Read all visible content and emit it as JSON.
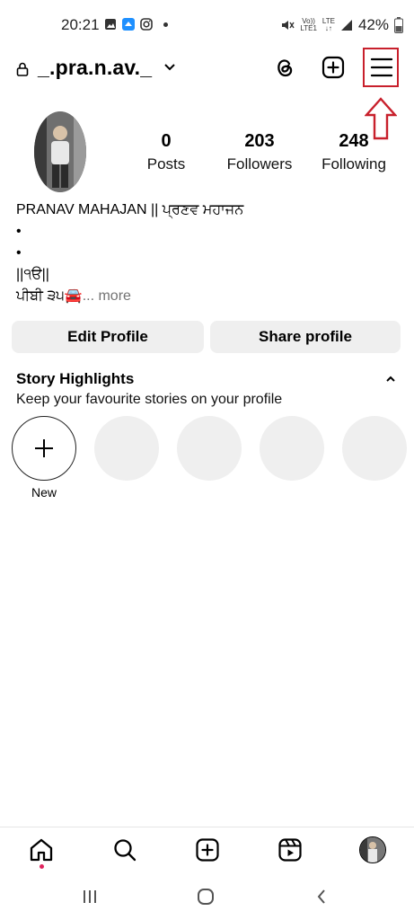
{
  "status": {
    "time": "20:21",
    "lte_top": "Vo))",
    "lte_bottom": "LTE1",
    "lte2_top": "LTE",
    "battery": "42%"
  },
  "header": {
    "username": "_.pra.n.av._"
  },
  "profile": {
    "stats": [
      {
        "value": "0",
        "label": "Posts"
      },
      {
        "value": "203",
        "label": "Followers"
      },
      {
        "value": "248",
        "label": "Following"
      }
    ],
    "bio": {
      "name": "PRANAV MAHAJAN || ਪ੍ਰਣਵ ਮਹਾਜਨ",
      "line2": "•",
      "line3": "•",
      "line4": "||੧ੳ||",
      "line5": "ਪੀਬੀ ੩੫🚘",
      "more": "... more"
    }
  },
  "buttons": {
    "edit": "Edit Profile",
    "share": "Share profile"
  },
  "highlights": {
    "title": "Story Highlights",
    "subtitle": "Keep your favourite stories on your profile",
    "new_label": "New"
  },
  "colors": {
    "annotation_red": "#c8202c",
    "button_bg": "#efefef",
    "notification_dot": "#e0245e"
  }
}
